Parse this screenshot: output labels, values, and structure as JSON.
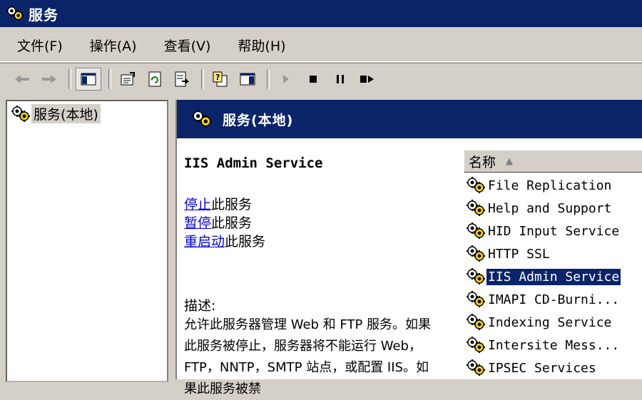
{
  "window": {
    "title": "服务",
    "icon": "services-gear-icon"
  },
  "menu": [
    {
      "label": "文件(F)"
    },
    {
      "label": "操作(A)"
    },
    {
      "label": "查看(V)"
    },
    {
      "label": "帮助(H)"
    }
  ],
  "toolbar": {
    "buttons": [
      "back-arrow-icon",
      "forward-arrow-icon",
      "show-hide-tree-icon",
      "properties-icon",
      "refresh-icon",
      "export-list-icon",
      "help-icon",
      "show-hide-action-pane-icon",
      "start-service-icon",
      "stop-service-icon",
      "pause-service-icon",
      "restart-service-icon"
    ]
  },
  "tree": {
    "root_label": "服务(本地)"
  },
  "content": {
    "header_title": "服务(本地)",
    "service_name": "IIS Admin Service",
    "actions": [
      {
        "link": "停止",
        "suffix": "此服务"
      },
      {
        "link": "暂停",
        "suffix": "此服务"
      },
      {
        "link": "重启动",
        "suffix": "此服务"
      }
    ],
    "description_label": "描述:",
    "description_text": "允许此服务器管理 Web 和 FTP 服务。如果此服务被停止，服务器将不能运行 Web，FTP，NNTP，SMTP 站点，或配置 IIS。如果此服务被禁"
  },
  "list": {
    "column_name": "名称",
    "sort_indicator": "▲",
    "rows": [
      {
        "name": "File Replication",
        "selected": false
      },
      {
        "name": "Help and Support",
        "selected": false
      },
      {
        "name": "HID Input Service",
        "selected": false
      },
      {
        "name": "HTTP SSL",
        "selected": false
      },
      {
        "name": "IIS Admin Service",
        "selected": true
      },
      {
        "name": "IMAPI CD-Burni...",
        "selected": false
      },
      {
        "name": "Indexing Service",
        "selected": false
      },
      {
        "name": "Intersite Mess...",
        "selected": false
      },
      {
        "name": "IPSEC Services",
        "selected": false
      }
    ]
  },
  "colors": {
    "title_bar": "#0a246a",
    "chrome": "#d4d0c8",
    "selection": "#0a246a",
    "link": "#0000ee"
  }
}
